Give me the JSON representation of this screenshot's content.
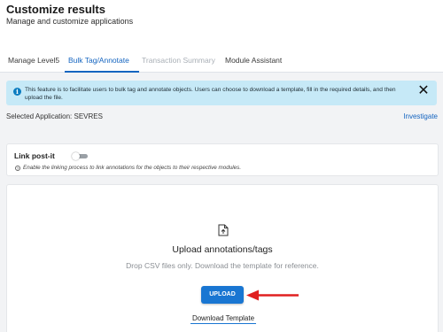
{
  "header": {
    "title": "Customize results",
    "subtitle": "Manage and customize applications"
  },
  "tabs": [
    {
      "label": "Manage Level5",
      "state": "normal"
    },
    {
      "label": "Bulk Tag/Annotate",
      "state": "active"
    },
    {
      "label": "Transaction Summary",
      "state": "disabled"
    },
    {
      "label": "Module Assistant",
      "state": "normal"
    }
  ],
  "alert": {
    "icon": "info-icon",
    "text": "This feature is to facilitate users to bulk tag and annotate objects. Users can choose to download a template, fill in the required details, and then upload the file.",
    "close_icon": "close-icon"
  },
  "selected_application": "Selected Application: SEVRES",
  "investigate_label": "Investigate",
  "link_postit": {
    "label": "Link post-it",
    "enabled": false,
    "help_text": "Enable the linking process to link annotations for the objects to their respective modules."
  },
  "upload": {
    "icon": "file-upload-icon",
    "title": "Upload annotations/tags",
    "hint": "Drop CSV files only. Download the template for reference.",
    "button_label": "UPLOAD",
    "download_label": "Download Template"
  },
  "colors": {
    "accent": "#1976d2",
    "alert_background": "#c6e9f7",
    "annotation_arrow": "#e02020"
  }
}
